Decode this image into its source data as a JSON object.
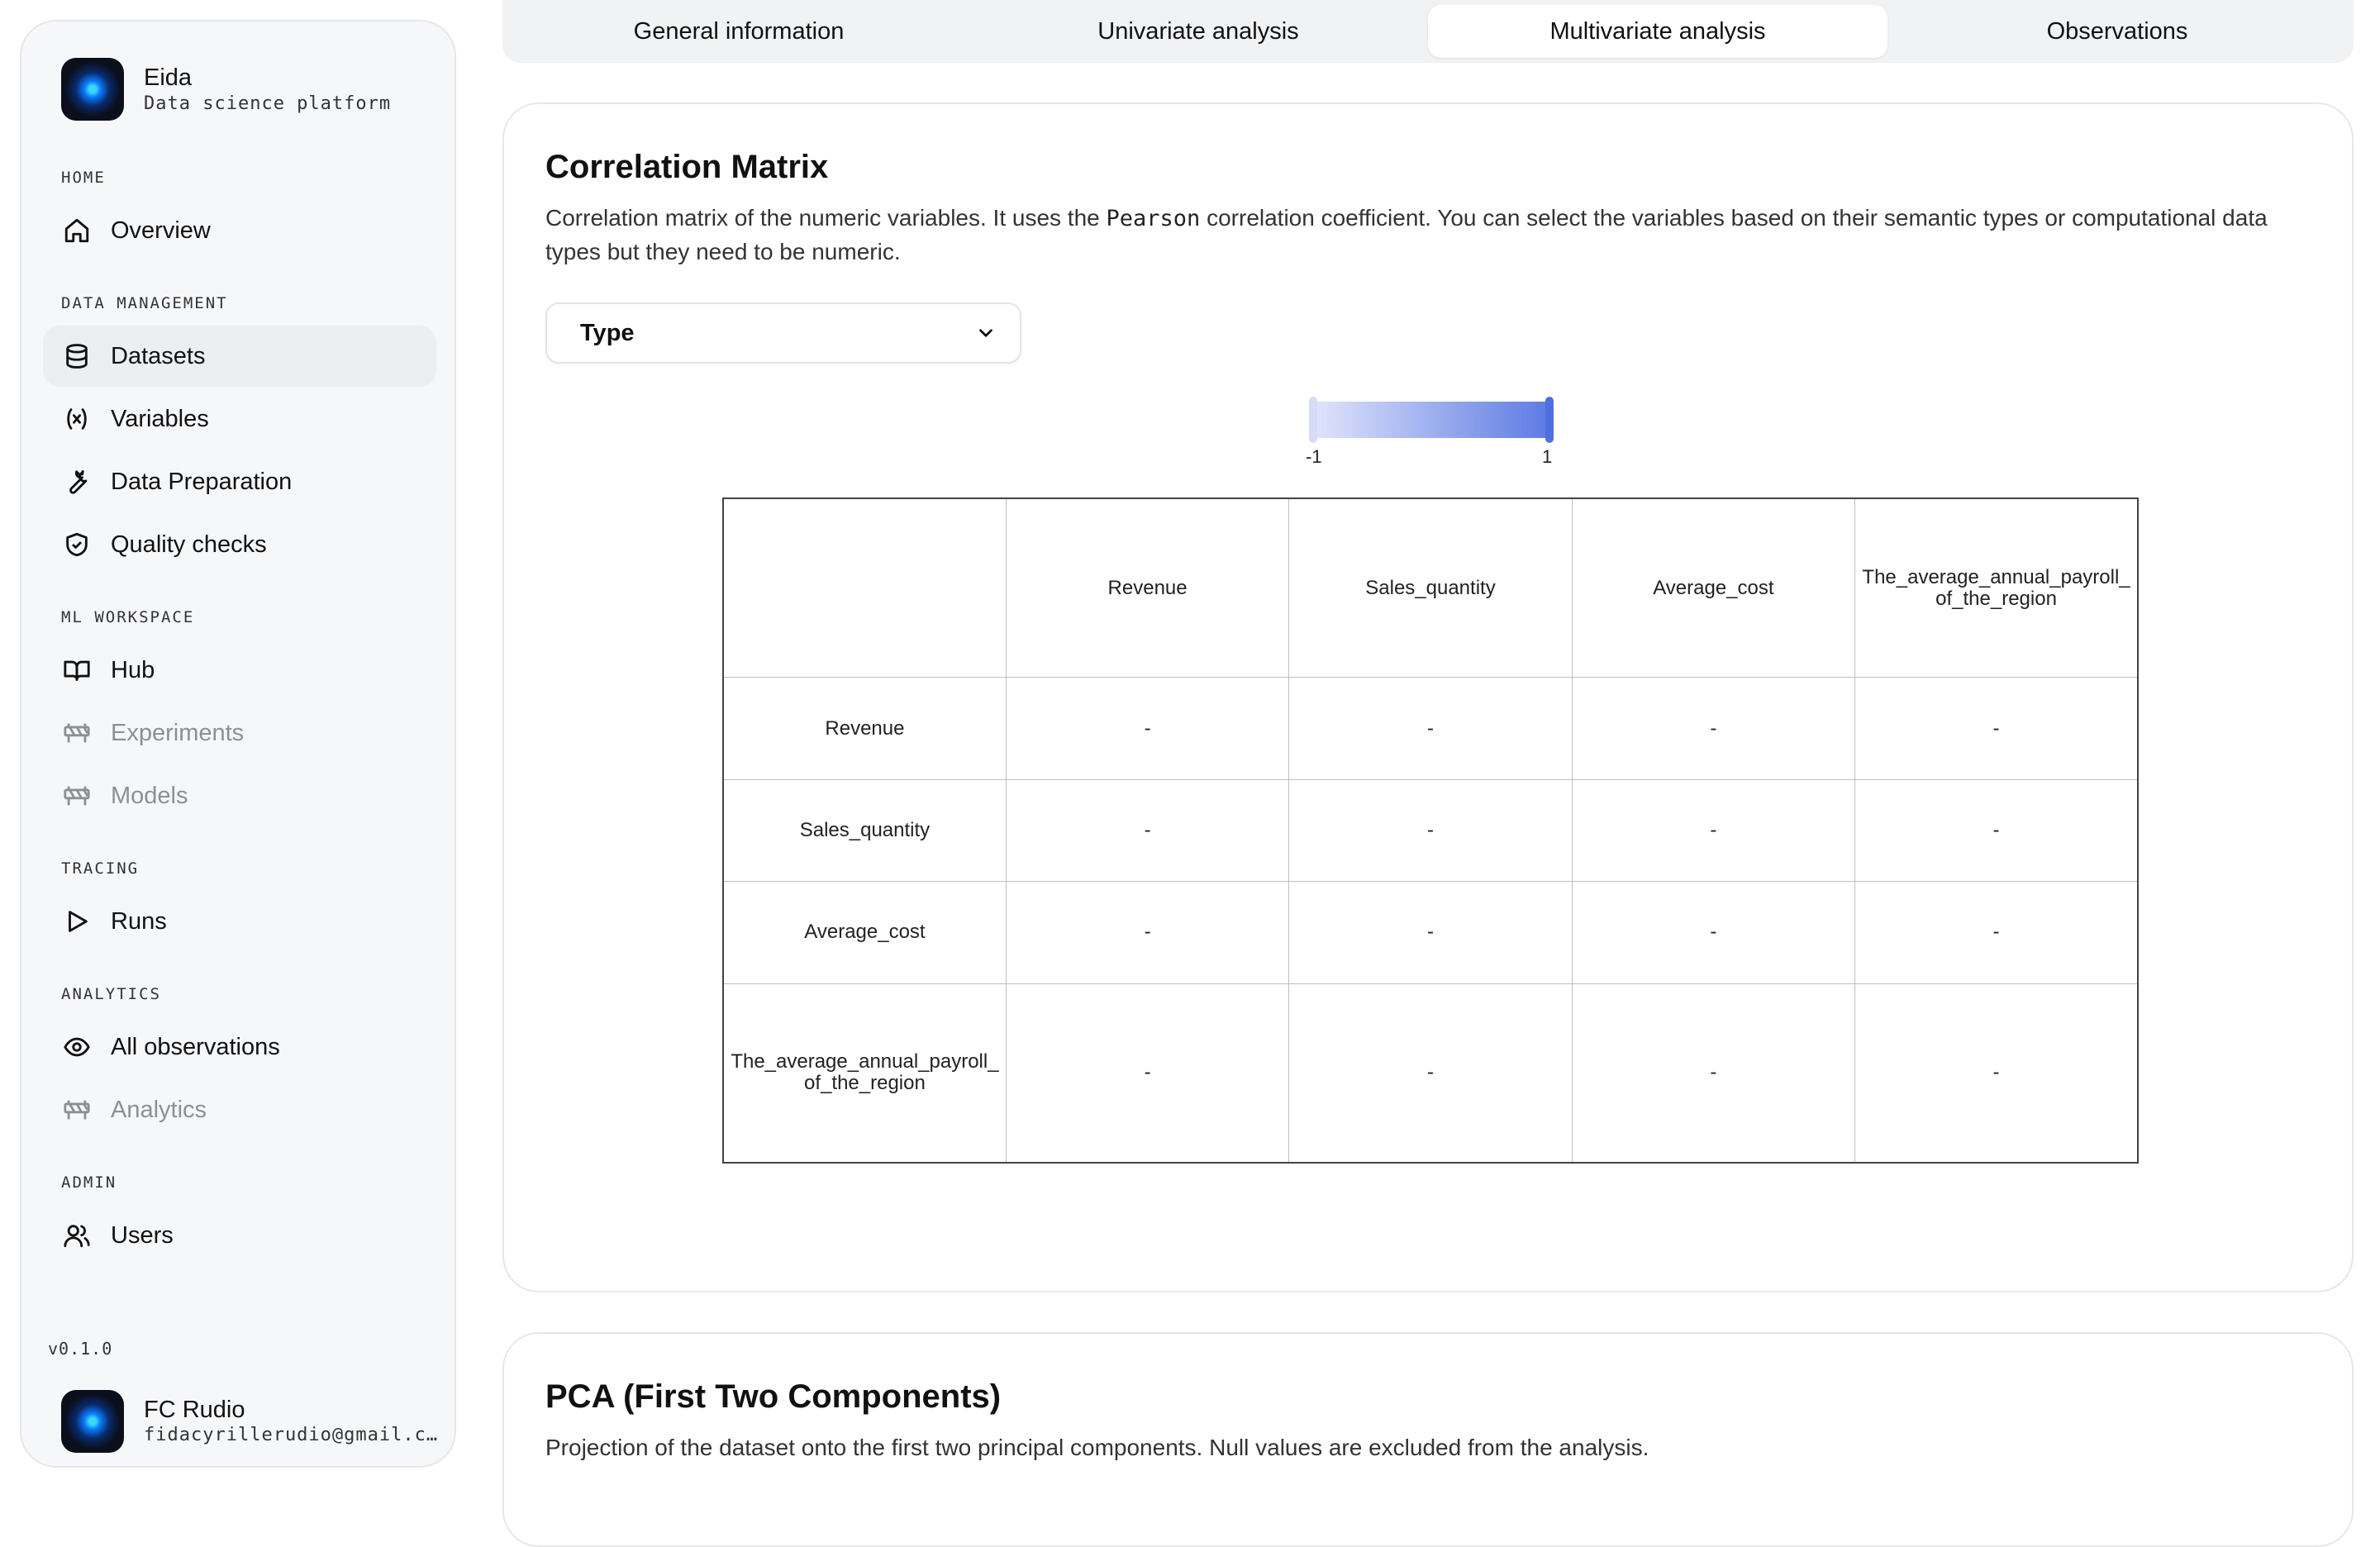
{
  "app": {
    "name": "Eida",
    "subtitle": "Data science platform",
    "version": "v0.1.0"
  },
  "sidebar": {
    "sections": {
      "home": "HOME",
      "data_management": "DATA MANAGEMENT",
      "ml_workspace": "ML WORKSPACE",
      "tracing": "TRACING",
      "analytics": "ANALYTICS",
      "admin": "ADMIN"
    },
    "items": {
      "overview": "Overview",
      "datasets": "Datasets",
      "variables": "Variables",
      "data_preparation": "Data Preparation",
      "quality_checks": "Quality checks",
      "hub": "Hub",
      "experiments": "Experiments",
      "models": "Models",
      "runs": "Runs",
      "all_observations": "All observations",
      "analytics": "Analytics",
      "users": "Users"
    },
    "active_item": "Datasets"
  },
  "user": {
    "name": "FC Rudio",
    "email": "fidacyrillerudio@gmail.c…"
  },
  "tabs": [
    "General information",
    "Univariate analysis",
    "Multivariate analysis",
    "Observations"
  ],
  "active_tab": "Multivariate analysis",
  "correlation": {
    "title": "Correlation Matrix",
    "description_before": "Correlation matrix of the numeric variables. It uses the ",
    "description_code": "Pearson",
    "description_after": " correlation coefficient. You can select the variables based on their semantic types or computational data types but they need to be numeric.",
    "select_value": "Type",
    "scale_min": "-1",
    "scale_max": "1",
    "scale_colors": {
      "min": "#e1e5fb",
      "max": "#5c7ae3"
    },
    "variables": [
      "Revenue",
      "Sales_quantity",
      "Average_cost",
      "The_average_annual_payroll_of_the_region"
    ],
    "cells": [
      [
        "-",
        "-",
        "-",
        "-"
      ],
      [
        "-",
        "-",
        "-",
        "-"
      ],
      [
        "-",
        "-",
        "-",
        "-"
      ],
      [
        "-",
        "-",
        "-",
        "-"
      ]
    ]
  },
  "pca": {
    "title": "PCA (First Two Components)",
    "description": "Projection of the dataset onto the first two principal components. Null values are excluded from the analysis."
  }
}
